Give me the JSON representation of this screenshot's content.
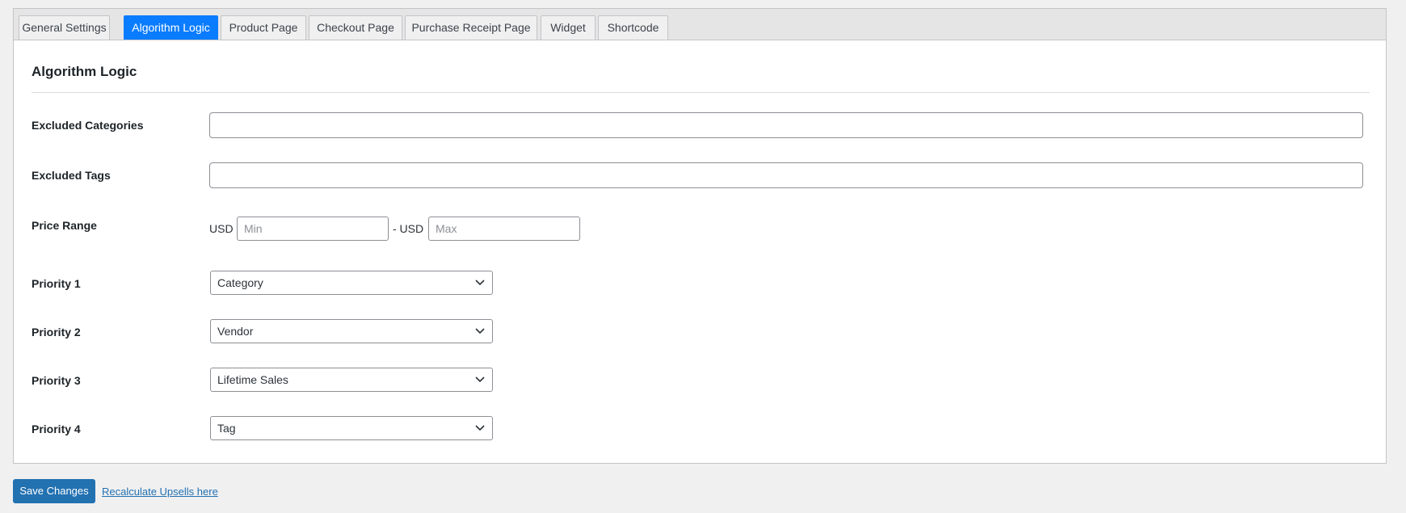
{
  "tabs": [
    {
      "label": "General Settings",
      "active": false
    },
    {
      "label": "Algorithm Logic",
      "active": true
    },
    {
      "label": "Product Page",
      "active": false
    },
    {
      "label": "Checkout Page",
      "active": false
    },
    {
      "label": "Purchase Receipt Page",
      "active": false
    },
    {
      "label": "Widget",
      "active": false
    },
    {
      "label": "Shortcode",
      "active": false
    }
  ],
  "section": {
    "title": "Algorithm Logic"
  },
  "fields": {
    "excluded_categories": {
      "label": "Excluded Categories",
      "value": ""
    },
    "excluded_tags": {
      "label": "Excluded Tags",
      "value": ""
    },
    "price_range": {
      "label": "Price Range",
      "currency_prefix": "USD",
      "separator": "- USD",
      "min_placeholder": "Min",
      "max_placeholder": "Max"
    },
    "priorities": [
      {
        "label": "Priority 1",
        "value": "Category"
      },
      {
        "label": "Priority 2",
        "value": "Vendor"
      },
      {
        "label": "Priority 3",
        "value": "Lifetime Sales"
      },
      {
        "label": "Priority 4",
        "value": "Tag"
      }
    ]
  },
  "footer": {
    "save_label": "Save Changes",
    "recalculate_label": "Recalculate Upsells here"
  },
  "colors": {
    "accent_tab": "#0a7cff",
    "primary_button": "#2271b1",
    "background": "#f0f0f1"
  },
  "icons": {
    "select_arrow": "chevron-down-icon"
  }
}
